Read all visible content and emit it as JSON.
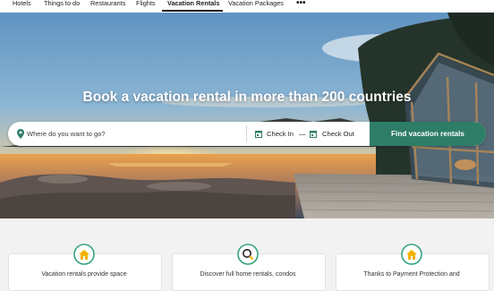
{
  "nav": {
    "items": [
      {
        "label": "Hotels",
        "active": false
      },
      {
        "label": "Things to do",
        "active": false
      },
      {
        "label": "Restaurants",
        "active": false
      },
      {
        "label": "Flights",
        "active": false
      },
      {
        "label": "Vacation Rentals",
        "active": true
      },
      {
        "label": "Vacation Packages",
        "active": false
      }
    ],
    "more_icon": "more-dots-icon"
  },
  "hero": {
    "title": "Book a vacation rental in more than 200 countries"
  },
  "search": {
    "where_placeholder": "Where do you want to go?",
    "where_value": "",
    "check_in": "Check In",
    "separator": "—",
    "check_out": "Check Out",
    "submit_label": "Find vacation rentals",
    "icons": {
      "location": "map-pin-icon",
      "calendar": "calendar-icon"
    }
  },
  "features": [
    {
      "icon": "house-icon",
      "text": "Vacation rentals provide space"
    },
    {
      "icon": "search-icon",
      "text": "Discover full home rentals, condos"
    },
    {
      "icon": "house-icon",
      "text": "Thanks to Payment Protection and"
    }
  ],
  "colors": {
    "brand_green": "#2e7d67",
    "accent_yellow": "#f2b203",
    "icon_ring": "#34a27e"
  }
}
